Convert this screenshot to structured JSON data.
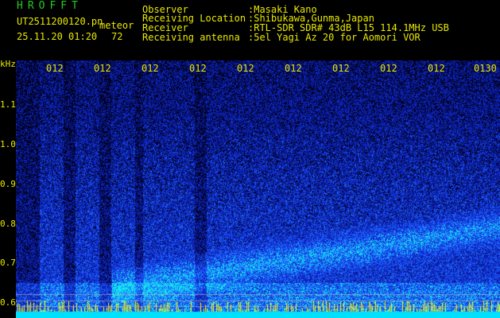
{
  "app": {
    "name": "HROFFT"
  },
  "file": {
    "name": "UT2511200120.pn",
    "suffix": "meteor"
  },
  "datetime": {
    "date": "25.11.20 01:20",
    "count": "72"
  },
  "info": [
    {
      "label": "Observer",
      "value": ":Masaki Kano"
    },
    {
      "label": "Receiving Location",
      "value": ":Shibukawa,Gunma,Japan"
    },
    {
      "label": "Receiver",
      "value": ":RTL-SDR SDR# 43dB L15 114.1MHz USB"
    },
    {
      "label": "Receiving antenna",
      "value": ":5el Yagi Az 20 for Aomori VOR"
    }
  ],
  "chart_data": {
    "type": "heatmap",
    "ylabel": "kHz",
    "y_ticks": [
      "1.1",
      "1.0",
      "0.9",
      "0.8",
      "0.7",
      "0.6"
    ],
    "x_ticks": [
      "012",
      "012",
      "012",
      "012",
      "012",
      "012",
      "012",
      "012",
      "012",
      "0130"
    ],
    "colors": {
      "background": "#000000",
      "low": "#0a1a8a",
      "mid": "#1e5cff",
      "high": "#00e0ff",
      "marker": "#ffff00"
    }
  }
}
